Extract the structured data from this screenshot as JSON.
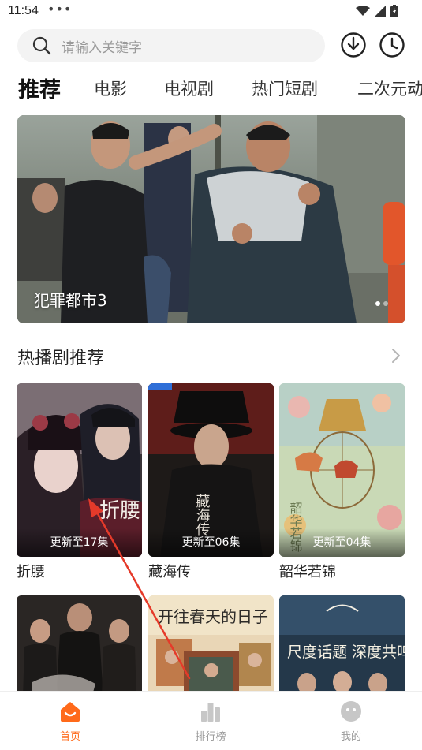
{
  "status_bar": {
    "time": "11:54",
    "dots": "•••"
  },
  "search": {
    "placeholder": "请输入关键字"
  },
  "tabs": [
    {
      "label": "推荐",
      "active": true
    },
    {
      "label": "电影",
      "active": false
    },
    {
      "label": "电视剧",
      "active": false
    },
    {
      "label": "热门短剧",
      "active": false
    },
    {
      "label": "二次元动",
      "active": false
    }
  ],
  "banner": {
    "title": "犯罪都市3",
    "page_count": 2,
    "active_page": 1
  },
  "section": {
    "title": "热播剧推荐"
  },
  "cards": [
    {
      "title": "折腰",
      "update": "更新至17集",
      "poster_text": "折腰"
    },
    {
      "title": "藏海传",
      "update": "更新至06集",
      "poster_text": "藏海传"
    },
    {
      "title": "韶华若锦",
      "update": "更新至04集",
      "poster_text": "韶华若锦"
    }
  ],
  "cards_row2": [
    {
      "poster_text": ""
    },
    {
      "poster_text": "开往春天的日子"
    },
    {
      "poster_text": "尺度话题 深度共鸣"
    }
  ],
  "nav": [
    {
      "label": "首页",
      "icon": "home-icon",
      "active": true
    },
    {
      "label": "排行榜",
      "icon": "ranking-icon",
      "active": false
    },
    {
      "label": "我的",
      "icon": "profile-icon",
      "active": false
    }
  ],
  "colors": {
    "accent": "#ff6a1a",
    "nav_inactive": "#9a9a9a",
    "annotation": "#e53a2a"
  }
}
